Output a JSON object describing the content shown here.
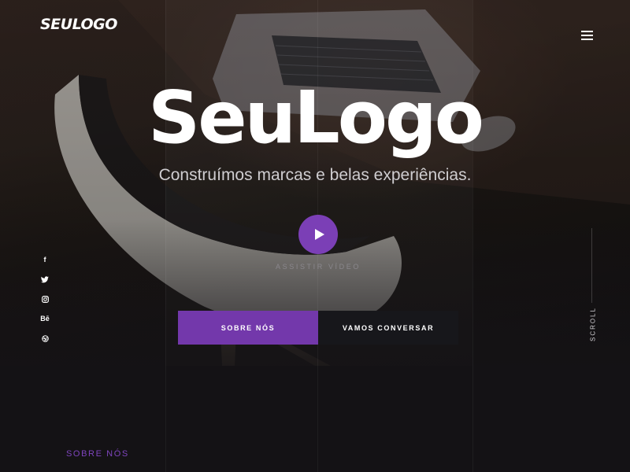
{
  "header": {
    "logo_text": "SEULOGO",
    "menu_icon": "hamburger-icon"
  },
  "hero": {
    "title": "SeuLogo",
    "subtitle": "Construímos marcas e belas experiências.",
    "play_icon": "play-icon",
    "video_label": "ASSISTIR VÍDEO",
    "primary_cta": "SOBRE NÓS",
    "secondary_cta": "VAMOS CONVERSAR"
  },
  "social": {
    "items": [
      {
        "name": "facebook-icon",
        "glyph": "f"
      },
      {
        "name": "twitter-icon",
        "glyph": ""
      },
      {
        "name": "instagram-icon",
        "glyph": ""
      },
      {
        "name": "behance-icon",
        "glyph": "Bē"
      },
      {
        "name": "dribbble-icon",
        "glyph": ""
      }
    ]
  },
  "scroll": {
    "label": "SCROLL"
  },
  "about": {
    "section_label": "SOBRE NÓS"
  },
  "colors": {
    "accent": "#7338ab",
    "play": "#7b3fb6",
    "background": "#141215",
    "secondary_button": "#17171b",
    "section_label": "#7e44bd"
  }
}
